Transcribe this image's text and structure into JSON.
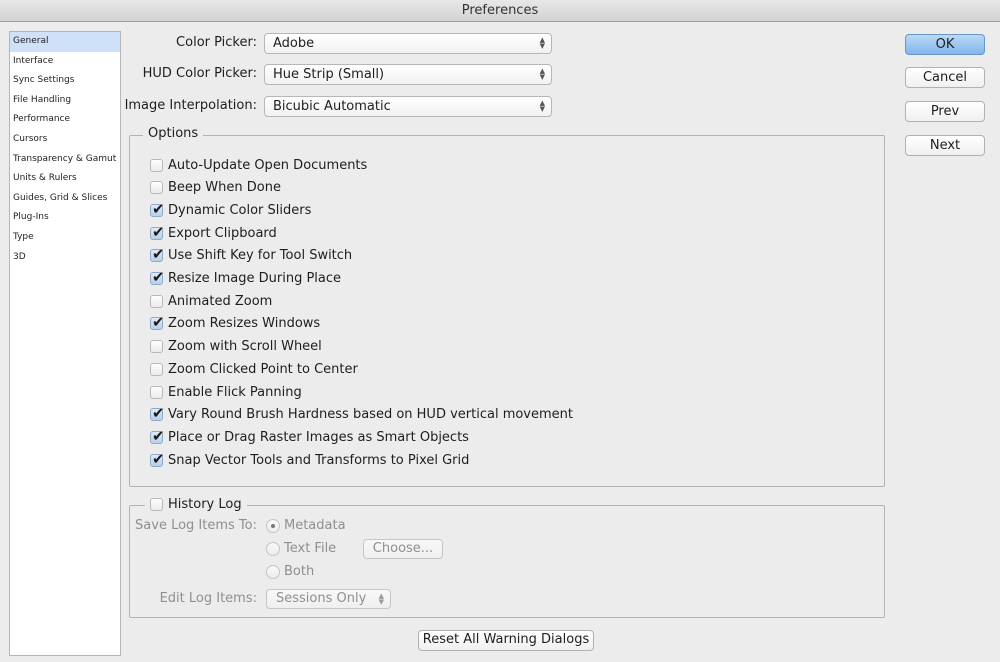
{
  "window": {
    "title": "Preferences"
  },
  "sidebar": {
    "items": [
      {
        "label": "General",
        "selected": true
      },
      {
        "label": "Interface"
      },
      {
        "label": "Sync Settings"
      },
      {
        "label": "File Handling"
      },
      {
        "label": "Performance"
      },
      {
        "label": "Cursors"
      },
      {
        "label": "Transparency & Gamut"
      },
      {
        "label": "Units & Rulers"
      },
      {
        "label": "Guides, Grid & Slices"
      },
      {
        "label": "Plug-Ins"
      },
      {
        "label": "Type"
      },
      {
        "label": "3D"
      }
    ]
  },
  "fields": {
    "color_picker": {
      "label": "Color Picker:",
      "value": "Adobe"
    },
    "hud_color_picker": {
      "label": "HUD Color Picker:",
      "value": "Hue Strip (Small)"
    },
    "image_interpolation": {
      "label": "Image Interpolation:",
      "value": "Bicubic Automatic"
    }
  },
  "options": {
    "title": "Options",
    "items": [
      {
        "label": "Auto-Update Open Documents",
        "checked": false
      },
      {
        "label": "Beep When Done",
        "checked": false
      },
      {
        "label": "Dynamic Color Sliders",
        "checked": true
      },
      {
        "label": "Export Clipboard",
        "checked": true
      },
      {
        "label": "Use Shift Key for Tool Switch",
        "checked": true
      },
      {
        "label": "Resize Image During Place",
        "checked": true
      },
      {
        "label": "Animated Zoom",
        "checked": false
      },
      {
        "label": "Zoom Resizes Windows",
        "checked": true
      },
      {
        "label": "Zoom with Scroll Wheel",
        "checked": false
      },
      {
        "label": "Zoom Clicked Point to Center",
        "checked": false
      },
      {
        "label": "Enable Flick Panning",
        "checked": false
      },
      {
        "label": "Vary Round Brush Hardness based on HUD vertical movement",
        "checked": true
      },
      {
        "label": "Place or Drag Raster Images as Smart Objects",
        "checked": true
      },
      {
        "label": "Snap Vector Tools and Transforms to Pixel Grid",
        "checked": true
      }
    ]
  },
  "history_log": {
    "title": "History Log",
    "checked": false,
    "save_to_label": "Save Log Items To:",
    "radios": [
      {
        "label": "Metadata",
        "selected": true
      },
      {
        "label": "Text File",
        "selected": false
      },
      {
        "label": "Both",
        "selected": false
      }
    ],
    "choose_label": "Choose...",
    "edit_label": "Edit Log Items:",
    "edit_value": "Sessions Only"
  },
  "buttons": {
    "ok": "OK",
    "cancel": "Cancel",
    "prev": "Prev",
    "next": "Next",
    "reset_warnings": "Reset All Warning Dialogs"
  }
}
